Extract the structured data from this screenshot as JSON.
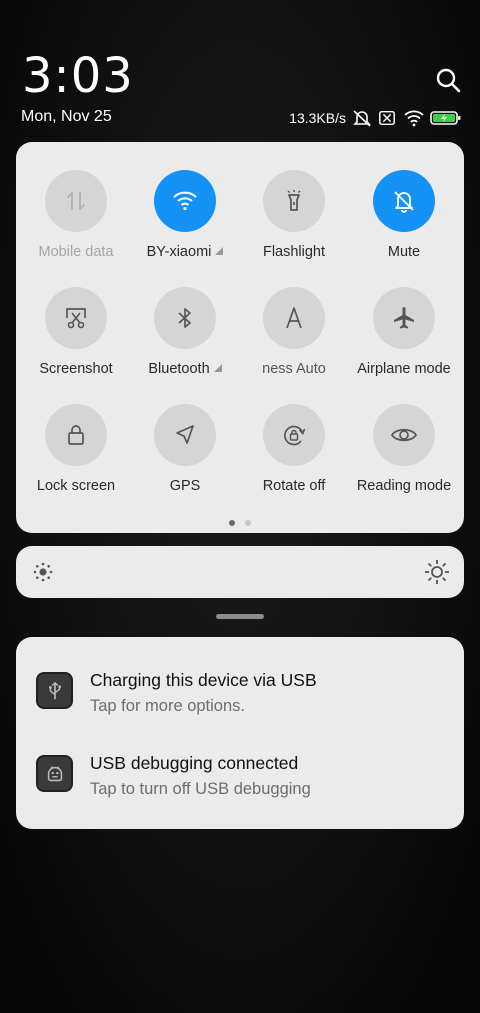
{
  "status_bar": {
    "time": "3:03",
    "date": "Mon, Nov 25",
    "net_speed": "13.3KB/s"
  },
  "quick_settings": {
    "tiles": [
      {
        "label": "Mobile data",
        "icon": "mobile-data-icon",
        "active": false,
        "disabled": true
      },
      {
        "label": "BY-xiaomi",
        "icon": "wifi-icon",
        "active": true,
        "expand": true
      },
      {
        "label": "Flashlight",
        "icon": "flashlight-icon",
        "active": false
      },
      {
        "label": "Mute",
        "icon": "bell-off-icon",
        "active": true
      },
      {
        "label": "Screenshot",
        "icon": "screenshot-icon",
        "active": false
      },
      {
        "label": "Bluetooth",
        "icon": "bluetooth-icon",
        "active": false,
        "expand": true
      },
      {
        "label": "Auto brightness",
        "icon": "auto-brightness-icon",
        "active": false,
        "scrolling": true,
        "label_visible": "ness      Auto"
      },
      {
        "label": "Airplane mode",
        "icon": "airplane-icon",
        "active": false
      },
      {
        "label": "Lock screen",
        "icon": "lock-icon",
        "active": false
      },
      {
        "label": "GPS",
        "icon": "location-arrow-icon",
        "active": false
      },
      {
        "label": "Rotate off",
        "icon": "rotation-lock-icon",
        "active": false
      },
      {
        "label": "Reading mode",
        "icon": "eye-icon",
        "active": false
      }
    ],
    "page_index": 1,
    "page_count": 2
  },
  "colors": {
    "accent": "#1592f5",
    "panel": "#ebebeb",
    "tile_inactive": "#d5d5d5"
  },
  "notifications": [
    {
      "title": "Charging this device via USB",
      "subtitle": "Tap for more options.",
      "icon": "usb-icon"
    },
    {
      "title": "USB debugging connected",
      "subtitle": "Tap to turn off USB debugging",
      "icon": "android-debug-icon"
    }
  ]
}
